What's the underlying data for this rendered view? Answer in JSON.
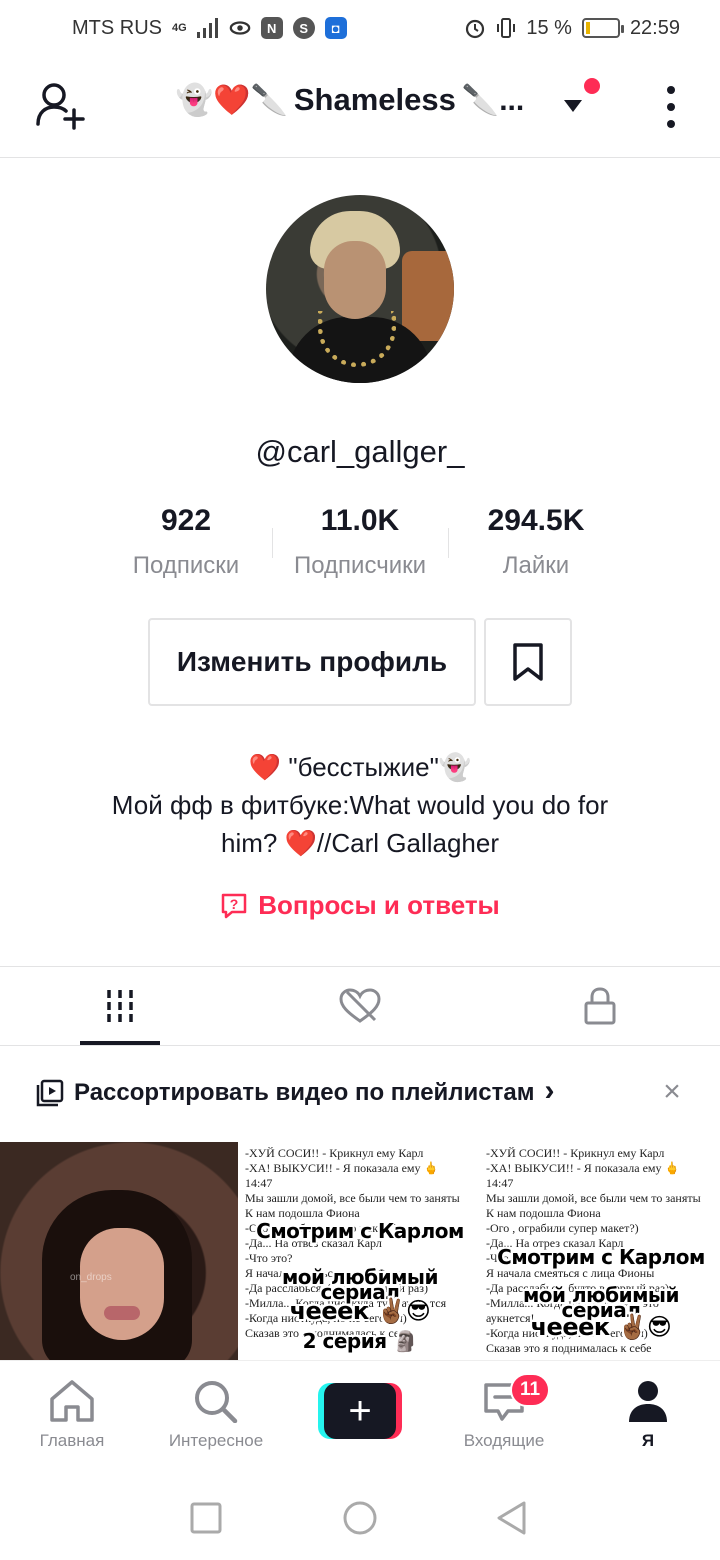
{
  "status_bar": {
    "carrier": "MTS RUS",
    "network": "4G",
    "battery_percent": "15 %",
    "battery_level": 0.15,
    "time": "22:59",
    "icons": [
      "signal-icon",
      "eye-icon",
      "nfc-icon",
      "shazam-icon",
      "app-icon",
      "alarm-icon",
      "vibrate-icon",
      "battery-icon"
    ]
  },
  "header": {
    "title_emojis": "👻❤️🔪",
    "title": "Shameless",
    "title_suffix": "🔪...",
    "has_notification_dot": true
  },
  "profile": {
    "username": "@carl_gallger_",
    "stats": [
      {
        "value": "922",
        "label": "Подписки"
      },
      {
        "value": "11.0K",
        "label": "Подписчики"
      },
      {
        "value": "294.5K",
        "label": "Лайки"
      }
    ],
    "edit_button": "Изменить профиль",
    "bio_line1": "❤️ \"бесстыжие\"👻",
    "bio_line2": "Мой фф в фитбуке:What would you do for",
    "bio_line3": "him? ❤️//Carl Gallagher",
    "qa_link": "Вопросы и ответы"
  },
  "tabs": [
    "videos-tab",
    "liked-tab",
    "private-tab"
  ],
  "playlist_banner": {
    "text": "Рассортировать видео по плейлистам",
    "arrow": "›",
    "close": "×"
  },
  "videos": [
    {
      "type": "photo",
      "watermark": "on_drops"
    },
    {
      "type": "text",
      "story": "-ХУЙ СОСИ!! - Крикнул ему Карл\n-ХА! ВЫКУСИ!! - Я показала ему 🖕\n14:47\nМы зашли домой, все были чем то заняты\nК нам подошла Фиона\n-Ого , ограбили супер макет?)\n-Да... На отвез сказал Карл\n-Что это?\nЯ начала смеяться с лица Фионы\n-Да расслабься, будто в первый раз)\n-Милла... Когда ниоткуда туда аукнется\n-Когда ниоткуда, но не сегодня)\nСказав это я поднималась к себе",
      "overlay1": "Смотрим с Карлом",
      "overlay2": "мой любимый сериал",
      "overlay3": "чееек ✌🏾😎",
      "overlay4": "2 серия 🗿"
    },
    {
      "type": "text",
      "story": "-ХУЙ СОСИ!! - Крикнул ему Карл\n-ХА! ВЫКУСИ!! - Я показала ему 🖕\n14:47\nМы зашли домой, все были чем то заняты\nК нам подошла Фиона\n-Ого , ограбили супер макет?)\n-Да... На отрез сказал Карл\n-Что это?\nЯ начала смеяться с лица Фионы\n-Да расслабься, будто в первый раз)\n-Милла... Когда ниоткуда туда это\nаукнется!\n-Когда ниоткуда, но не сегодня)\nСказав это я поднималась к себе",
      "overlay1": "Смотрим с Карлом",
      "overlay2": "мой любимый сериал",
      "overlay3": "чееек ✌🏾😎",
      "overlay4": ""
    }
  ],
  "bottom_nav": {
    "home": "Главная",
    "discover": "Интересное",
    "create": "+",
    "inbox": "Входящие",
    "inbox_badge": "11",
    "me": "Я"
  },
  "colors": {
    "accent": "#fe2c55",
    "cyan": "#25f4ee",
    "text": "#161823",
    "secondary": "#8a8b91",
    "border": "#e3e3e4"
  }
}
